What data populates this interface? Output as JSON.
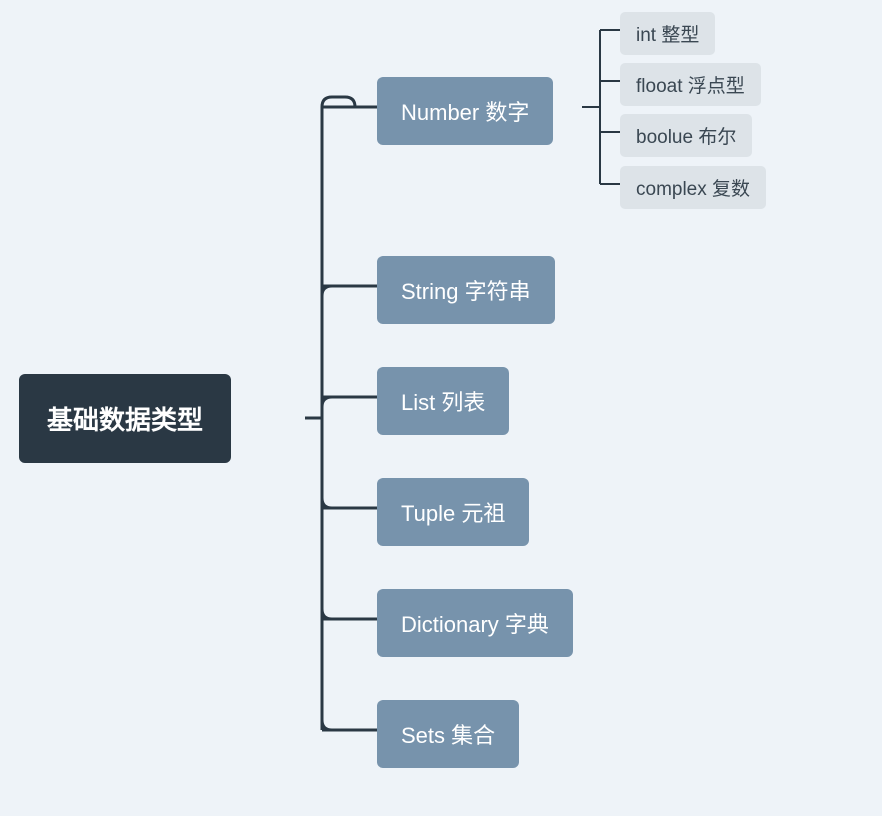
{
  "root": {
    "label": "基础数据类型"
  },
  "level1": [
    {
      "label": "Number 数字"
    },
    {
      "label": "String 字符串"
    },
    {
      "label": "List 列表"
    },
    {
      "label": "Tuple 元祖"
    },
    {
      "label": "Dictionary 字典"
    },
    {
      "label": "Sets 集合"
    }
  ],
  "level2_number": [
    {
      "label": "int 整型"
    },
    {
      "label": "flooat 浮点型"
    },
    {
      "label": "boolue 布尔"
    },
    {
      "label": "complex 复数"
    }
  ],
  "colors": {
    "background": "#eef3f8",
    "root_bg": "#2a3844",
    "mid_bg": "#7793ac",
    "leaf_bg": "#dde3e8",
    "connector": "#2a3844"
  }
}
